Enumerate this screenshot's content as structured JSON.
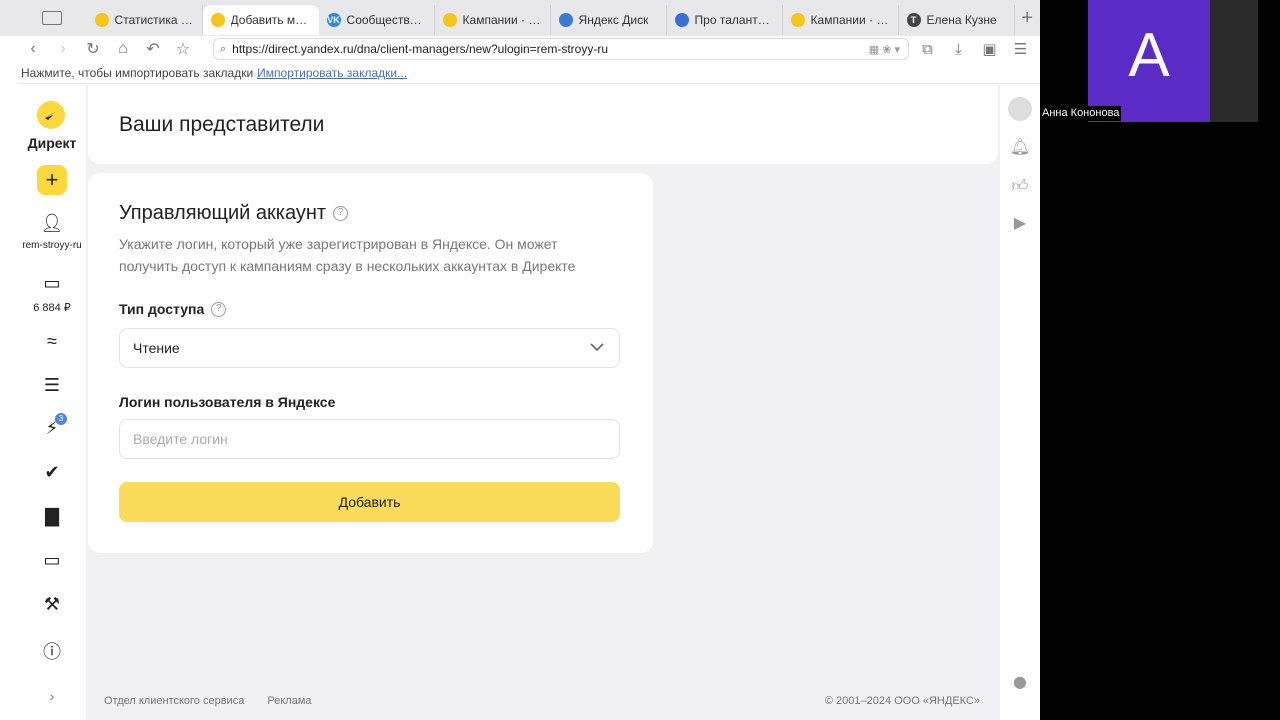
{
  "tabs": [
    {
      "label": "Статистика п...",
      "fav_color": "#f5c518",
      "active": false
    },
    {
      "label": "Добавить ме...",
      "fav_color": "#f5c518",
      "active": true
    },
    {
      "label": "Сообщество...",
      "fav_color": "#2787f5",
      "active": false,
      "fav_text": "VK"
    },
    {
      "label": "Кампании · k...",
      "fav_color": "#f5c518",
      "active": false
    },
    {
      "label": "Яндекс Диск",
      "fav_color": "#3a7bd5",
      "active": false
    },
    {
      "label": "Про таланты...",
      "fav_color": "#3a6fd8",
      "active": false
    },
    {
      "label": "Кампании · k...",
      "fav_color": "#f5c518",
      "active": false
    },
    {
      "label": "Елена Кузне",
      "fav_color": "#444444",
      "active": false,
      "fav_text": "T"
    }
  ],
  "address": {
    "url": "https://direct.yandex.ru/dna/client-managers/new?ulogin=rem-stroyy-ru"
  },
  "bookmarks": {
    "hint": "Нажмите, чтобы импортировать закладки",
    "link": "Импортировать закладки..."
  },
  "sidebar": {
    "brand": "Директ",
    "account": "rem-stroyy-ru",
    "balance": "6 884 ₽",
    "badge": "3"
  },
  "header": {
    "title": "Ваши представители"
  },
  "form": {
    "title": "Управляющий аккаунт",
    "description": "Укажите логин, который уже зарегистрирован в Яндексе. Он может получить доступ к кампаниям сразу в нескольких аккаунтах в Директе",
    "access_label": "Тип доступа",
    "access_value": "Чтение",
    "login_label": "Логин пользователя в Яндексе",
    "login_placeholder": "Введите логин",
    "submit_label": "Добавить"
  },
  "footer": {
    "links": [
      "Отдел клиентского сервиса",
      "Реклама"
    ],
    "copyright": "© 2001–2024 ООО «ЯНДЕКС»"
  },
  "video": {
    "letter": "А",
    "name": "Анна Кононова"
  },
  "colors": {
    "accent": "#fcd83d",
    "button": "#fbdc5a",
    "tile": "#5c2bc7"
  }
}
